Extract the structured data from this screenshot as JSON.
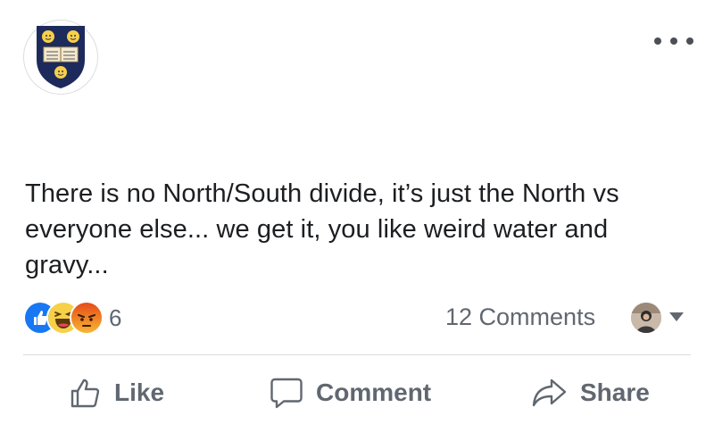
{
  "post": {
    "text": "There is no North/South divide, it’s just the North vs everyone else... we get it, you like weird water and gravy..."
  },
  "reactions": {
    "types": [
      "like",
      "haha",
      "angry"
    ],
    "count": "6"
  },
  "comments": {
    "count_label": "12 Comments"
  },
  "actions": {
    "like_label": "Like",
    "comment_label": "Comment",
    "share_label": "Share"
  },
  "colors": {
    "like_blue": "#1877f2",
    "haha_yellow": "#f7d04a",
    "angry_orange": "#e9710f",
    "crest_navy": "#1d2a5c",
    "text_gray": "#606770"
  }
}
